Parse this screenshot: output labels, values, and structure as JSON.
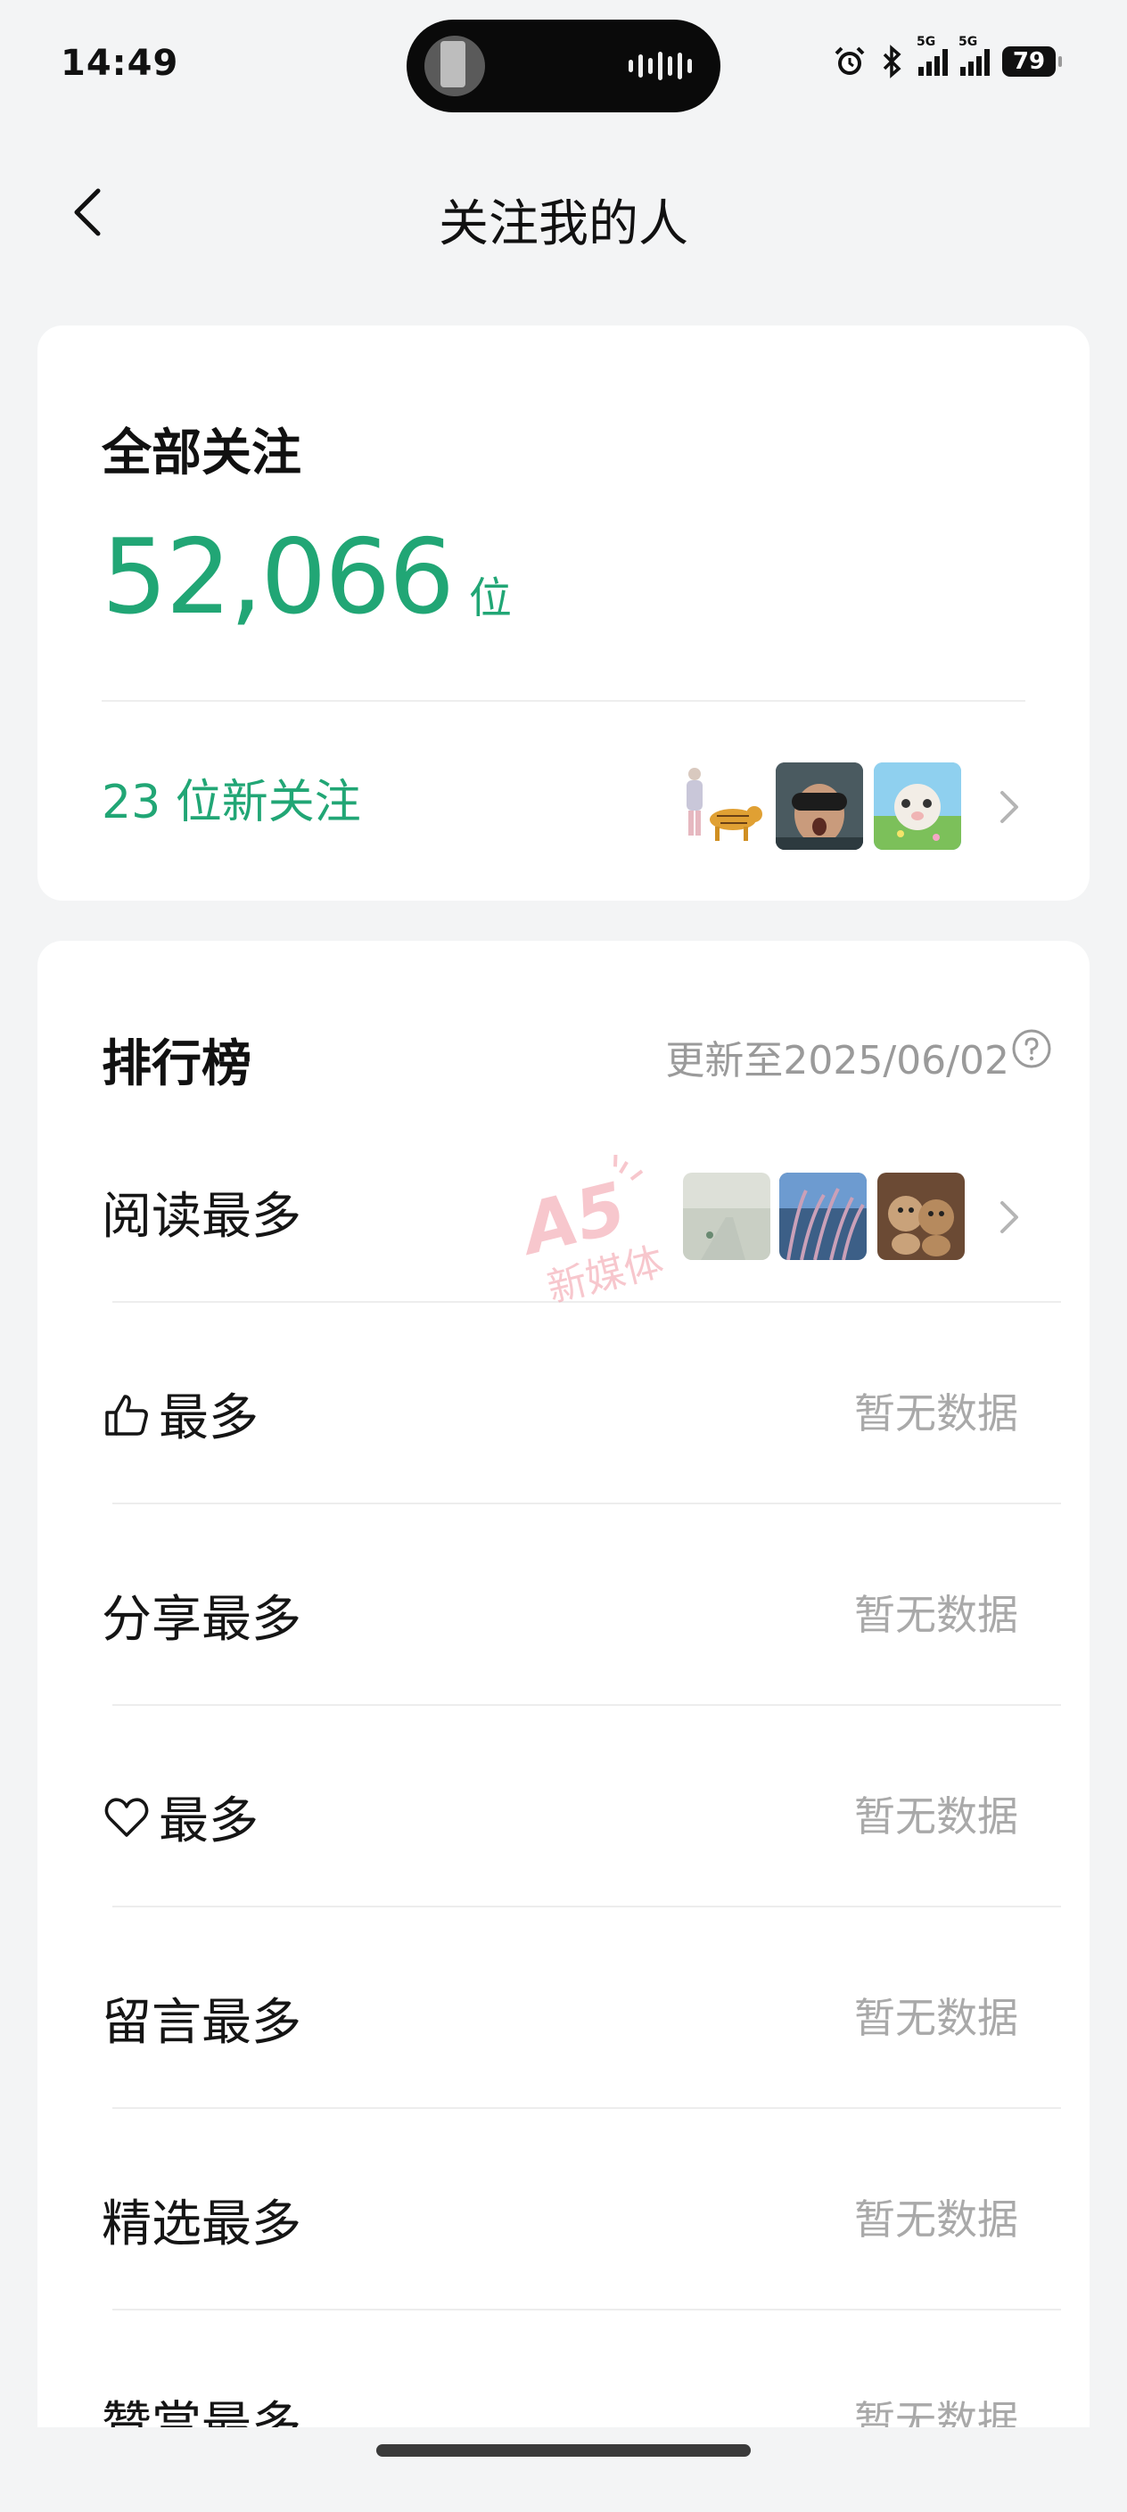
{
  "status_bar": {
    "time": "14:49",
    "network_1": "5G",
    "network_2": "5G",
    "battery": "79"
  },
  "nav": {
    "title": "关注我的人",
    "back_icon": "chevron-left-icon"
  },
  "followers": {
    "title": "全部关注",
    "count": "52,066",
    "unit": "位",
    "new_followers": "23 位新关注",
    "avatars": [
      "tiger-walk-avatar",
      "goggles-avatar",
      "lamb-avatar"
    ]
  },
  "ranking": {
    "title": "排行榜",
    "updated": "更新至2025/06/02",
    "watermark_text": "A5 新媒体",
    "rows": [
      {
        "label": "阅读最多",
        "value": "",
        "icon": ""
      },
      {
        "label": "最多",
        "value": "暂无数据",
        "icon": "thumbs-up-icon"
      },
      {
        "label": "分享最多",
        "value": "暂无数据",
        "icon": ""
      },
      {
        "label": "最多",
        "value": "暂无数据",
        "icon": "heart-icon"
      },
      {
        "label": "留言最多",
        "value": "暂无数据",
        "icon": ""
      },
      {
        "label": "精选最多",
        "value": "暂无数据",
        "icon": ""
      },
      {
        "label": "赞赏最多",
        "value": "暂无数据",
        "icon": ""
      }
    ]
  },
  "colors": {
    "accent": "#21a675",
    "background": "#f3f4f5",
    "muted": "#a9a9a9"
  }
}
